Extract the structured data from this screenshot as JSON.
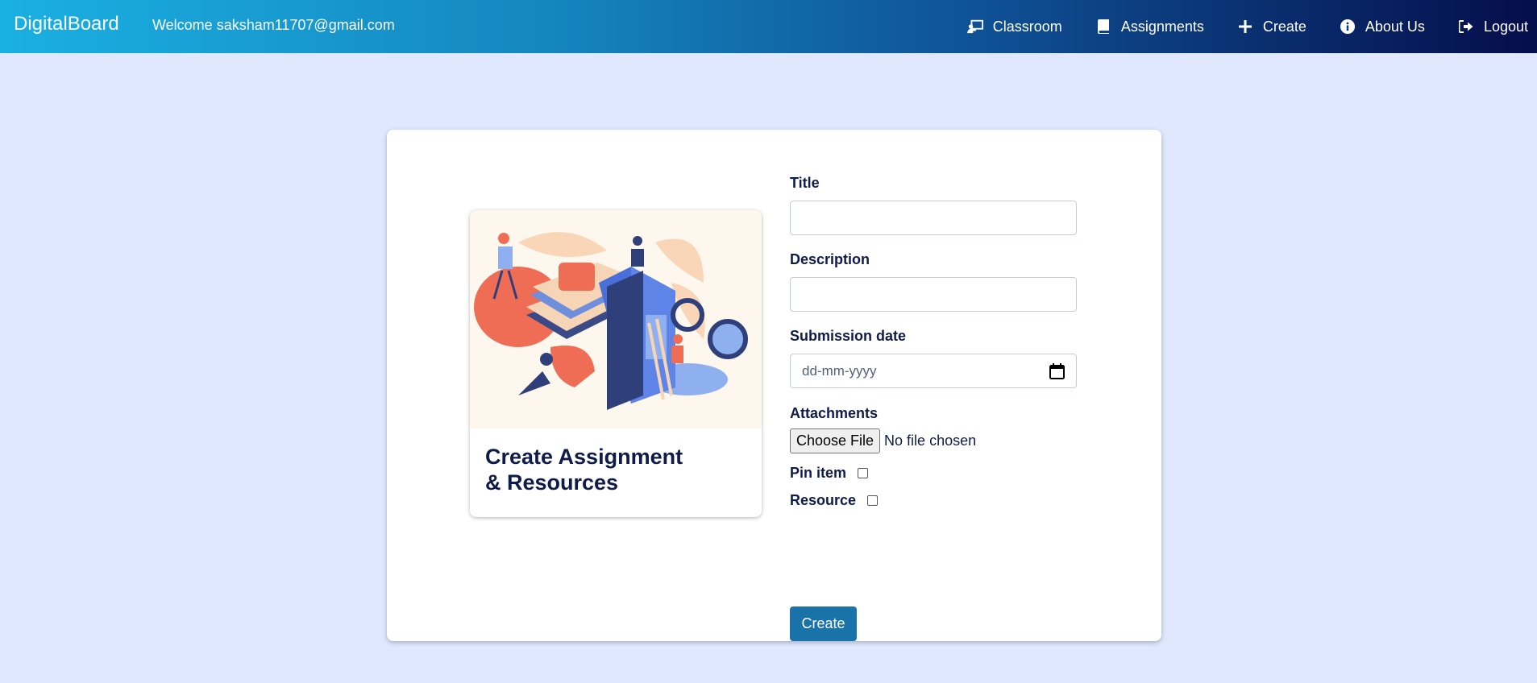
{
  "navbar": {
    "brand": "DigitalBoard",
    "welcome": "Welcome saksham11707@gmail.com",
    "links": [
      {
        "label": "Classroom",
        "icon": "chalkboard-teacher-icon"
      },
      {
        "label": "Assignments",
        "icon": "book-icon"
      },
      {
        "label": "Create",
        "icon": "plus-icon"
      },
      {
        "label": "About Us",
        "icon": "info-circle-icon"
      },
      {
        "label": "Logout",
        "icon": "sign-out-icon"
      }
    ]
  },
  "card": {
    "title_line1": "Create Assignment",
    "title_line2": "& Resources"
  },
  "form": {
    "title_label": "Title",
    "title_value": "",
    "description_label": "Description",
    "description_value": "",
    "date_label": "Submission date",
    "date_placeholder": "dd-mm-yyyy",
    "attachments_label": "Attachments",
    "file_button": "Choose File",
    "file_status": "No file chosen",
    "pin_label": "Pin item",
    "resource_label": "Resource",
    "submit": "Create"
  },
  "colors": {
    "background": "#dfe8ff",
    "primary_button": "#1a73a8",
    "text": "#0f1b4a"
  }
}
